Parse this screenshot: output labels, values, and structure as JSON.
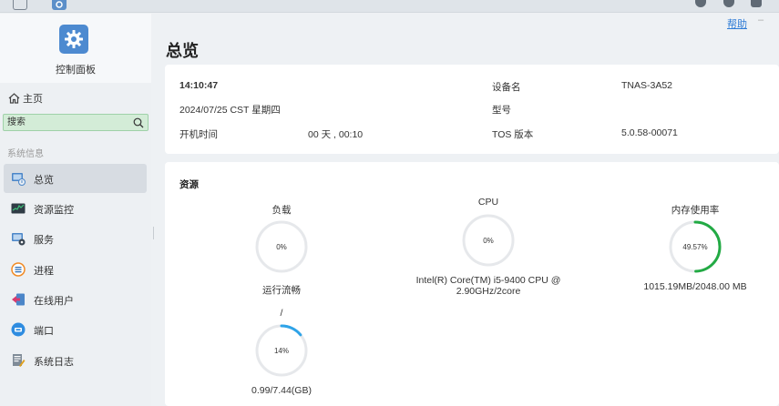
{
  "sidebar": {
    "app_title": "控制面板",
    "home_label": "主页",
    "search_placeholder": "搜索",
    "section_label": "系统信息",
    "items": [
      {
        "label": "总览",
        "icon": "overview-icon"
      },
      {
        "label": "资源监控",
        "icon": "monitor-icon"
      },
      {
        "label": "服务",
        "icon": "service-icon"
      },
      {
        "label": "进程",
        "icon": "process-icon"
      },
      {
        "label": "在线用户",
        "icon": "online-user-icon"
      },
      {
        "label": "端口",
        "icon": "port-icon"
      },
      {
        "label": "系统日志",
        "icon": "log-icon"
      }
    ]
  },
  "header": {
    "help_label": "帮助",
    "page_title": "总览"
  },
  "info": {
    "time": "14:10:47",
    "date": "2024/07/25 CST 星期四",
    "uptime_label": "开机时间",
    "uptime_value": "00 天 , 00:10",
    "device_name_label": "设备名",
    "device_name_value": "TNAS-3A52",
    "model_label": "型号",
    "model_value": "",
    "tos_label": "TOS 版本",
    "tos_value": "5.0.58-00071"
  },
  "resources": {
    "title": "资源",
    "load": {
      "label": "负载",
      "percent_text": "0%",
      "fraction": 0.0
    },
    "cpu": {
      "label": "CPU",
      "percent_text": "0%",
      "fraction": 0.0,
      "detail": "Intel(R) Core(TM) i5-9400 CPU @ 2.90GHz/2core"
    },
    "memory": {
      "label": "内存使用率",
      "percent_text": "49.57%",
      "fraction": 0.4957,
      "detail": "1015.19MB/2048.00 MB"
    },
    "fluency": {
      "label": "运行流畅",
      "sub_label": "/",
      "percent_text": "14%",
      "fraction": 0.14,
      "detail": "0.99/7.44(GB)"
    }
  },
  "colors": {
    "accent": "#2d7bd6",
    "memory_ring": "#22aa44",
    "fluency_ring": "#2ea3e8",
    "ring_track": "#e6e8eb",
    "search_bg": "#d3ecd7"
  }
}
